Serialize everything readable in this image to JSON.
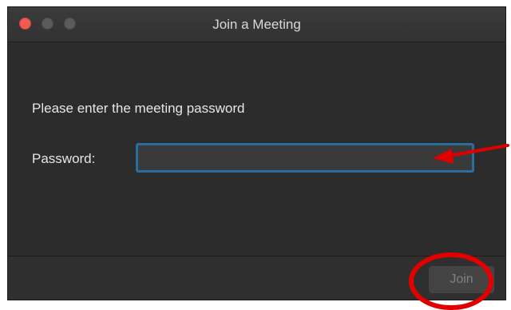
{
  "window": {
    "title": "Join a Meeting",
    "traffic_lights": [
      "close",
      "minimize",
      "maximize"
    ]
  },
  "dialog": {
    "prompt": "Please enter the meeting password",
    "password_label": "Password:",
    "password_value": "",
    "join_label": "Join"
  },
  "annotations": {
    "arrow_color": "#e00000",
    "circle_color": "#e00000"
  },
  "colors": {
    "window_bg": "#2c2c2c",
    "input_focus_border": "#2b6d9c",
    "close_button": "#ee5b52"
  }
}
